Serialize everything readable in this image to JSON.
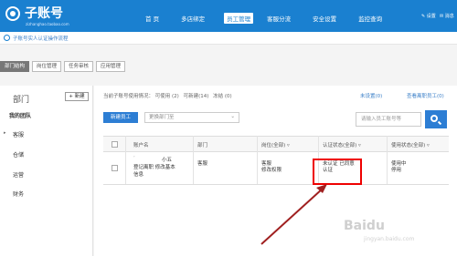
{
  "app": {
    "title": "子账号",
    "subtitle": "zizhanghao.taobao.com"
  },
  "nav": {
    "items": [
      "首 页",
      "多店绑定",
      "员工管理",
      "客服分流",
      "安全设置",
      "监控查询"
    ],
    "active_index": 2,
    "right_links": [
      "设置",
      "消息"
    ]
  },
  "notice": {
    "text": "子账号实人认证操作流程"
  },
  "subtabs": {
    "items": [
      "部门结构",
      "岗位管理",
      "任务审核",
      "应用管理"
    ],
    "active_index": 0
  },
  "left": {
    "title": "部门",
    "new_button": "+ 新建",
    "tree": [
      {
        "label": "我的团队",
        "bold": true,
        "expandable": false
      },
      {
        "label": "客服",
        "bold": false,
        "expandable": true
      },
      {
        "label": "仓储",
        "bold": false,
        "expandable": false
      },
      {
        "label": "运营",
        "bold": false,
        "expandable": false
      },
      {
        "label": "财务",
        "bold": false,
        "expandable": false
      }
    ]
  },
  "main": {
    "summary_prefix": "当前子账号使用情况：",
    "summary_usable": "可使用 (2)",
    "summary_created": "可新建(14)",
    "summary_frozen": "冻结 (0)",
    "link_unbind": "未设置(0)",
    "link_view": "查看离职员工(0)",
    "add_staff": "新建员工",
    "filter_placeholder": "更换部门至",
    "search_placeholder": "请输入员工账号等",
    "table": {
      "headers": [
        "账户名",
        "部门",
        "岗位(全部)",
        "认证状态(全部)",
        "使用状态(全部)"
      ],
      "rows": [
        {
          "account_prefix": "‘",
          "account_name": "小五",
          "account_actions": "登记离职 修改基本",
          "account_actions2": "信息",
          "department": "客服",
          "position": "客服",
          "position_action": "修改权限",
          "auth_status": "未认证 已同意",
          "auth_action": "认证",
          "use_status": "使用中",
          "use_action": "停用"
        }
      ]
    }
  },
  "watermark": {
    "text": "Baidu",
    "sub": "jingyan.baidu.com"
  },
  "colors": {
    "brand": "#1a80d0",
    "button": "#2d7ed4",
    "highlight": "#e00000",
    "arrow": "#a02020"
  }
}
